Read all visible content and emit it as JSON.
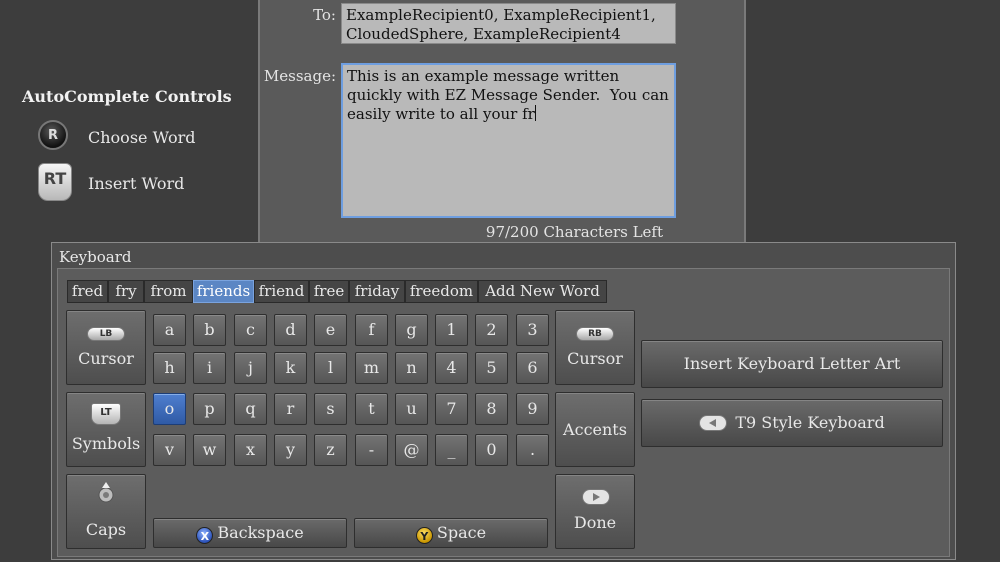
{
  "message_form": {
    "to_label": "To:",
    "to_value": "ExampleRecipient0, ExampleRecipient1,\nCloudedSphere, ExampleRecipient4",
    "message_label": "Message:",
    "message_value": "This is an example message written\nquickly with EZ Message Sender.  You can\neasily write to all your fr",
    "chars_left": "97/200 Characters Left"
  },
  "autocomplete": {
    "title": "AutoComplete Controls",
    "choose_button": "R",
    "choose_label": "Choose Word",
    "insert_button": "RT",
    "insert_label": "Insert Word"
  },
  "keyboard": {
    "title": "Keyboard",
    "suggestions": [
      "fred",
      "fry",
      "from",
      "friends",
      "friend",
      "free",
      "friday",
      "freedom",
      "Add New Word"
    ],
    "selected_suggestion": "friends",
    "rows": [
      [
        "a",
        "b",
        "c",
        "d",
        "e",
        "f",
        "g",
        "1",
        "2",
        "3"
      ],
      [
        "h",
        "i",
        "j",
        "k",
        "l",
        "m",
        "n",
        "4",
        "5",
        "6"
      ],
      [
        "o",
        "p",
        "q",
        "r",
        "s",
        "t",
        "u",
        "7",
        "8",
        "9"
      ],
      [
        "v",
        "w",
        "x",
        "y",
        "z",
        "-",
        "@",
        "_",
        "0",
        "."
      ]
    ],
    "selected_key": "o",
    "lb_label": "LB",
    "cursor_left_label": "Cursor",
    "lt_label": "LT",
    "symbols_label": "Symbols",
    "caps_label": "Caps",
    "rb_label": "RB",
    "cursor_right_label": "Cursor",
    "accents_label": "Accents",
    "done_label": "Done",
    "backspace_button": "X",
    "backspace_label": "Backspace",
    "space_button": "Y",
    "space_label": "Space",
    "letter_art_label": "Insert Keyboard Letter Art",
    "t9_label": "T9 Style Keyboard"
  },
  "colors": {
    "background": "#3d3d3d",
    "accent_blue": "#5b86c4",
    "x_button": "#2c52b8",
    "y_button": "#e0b000"
  }
}
